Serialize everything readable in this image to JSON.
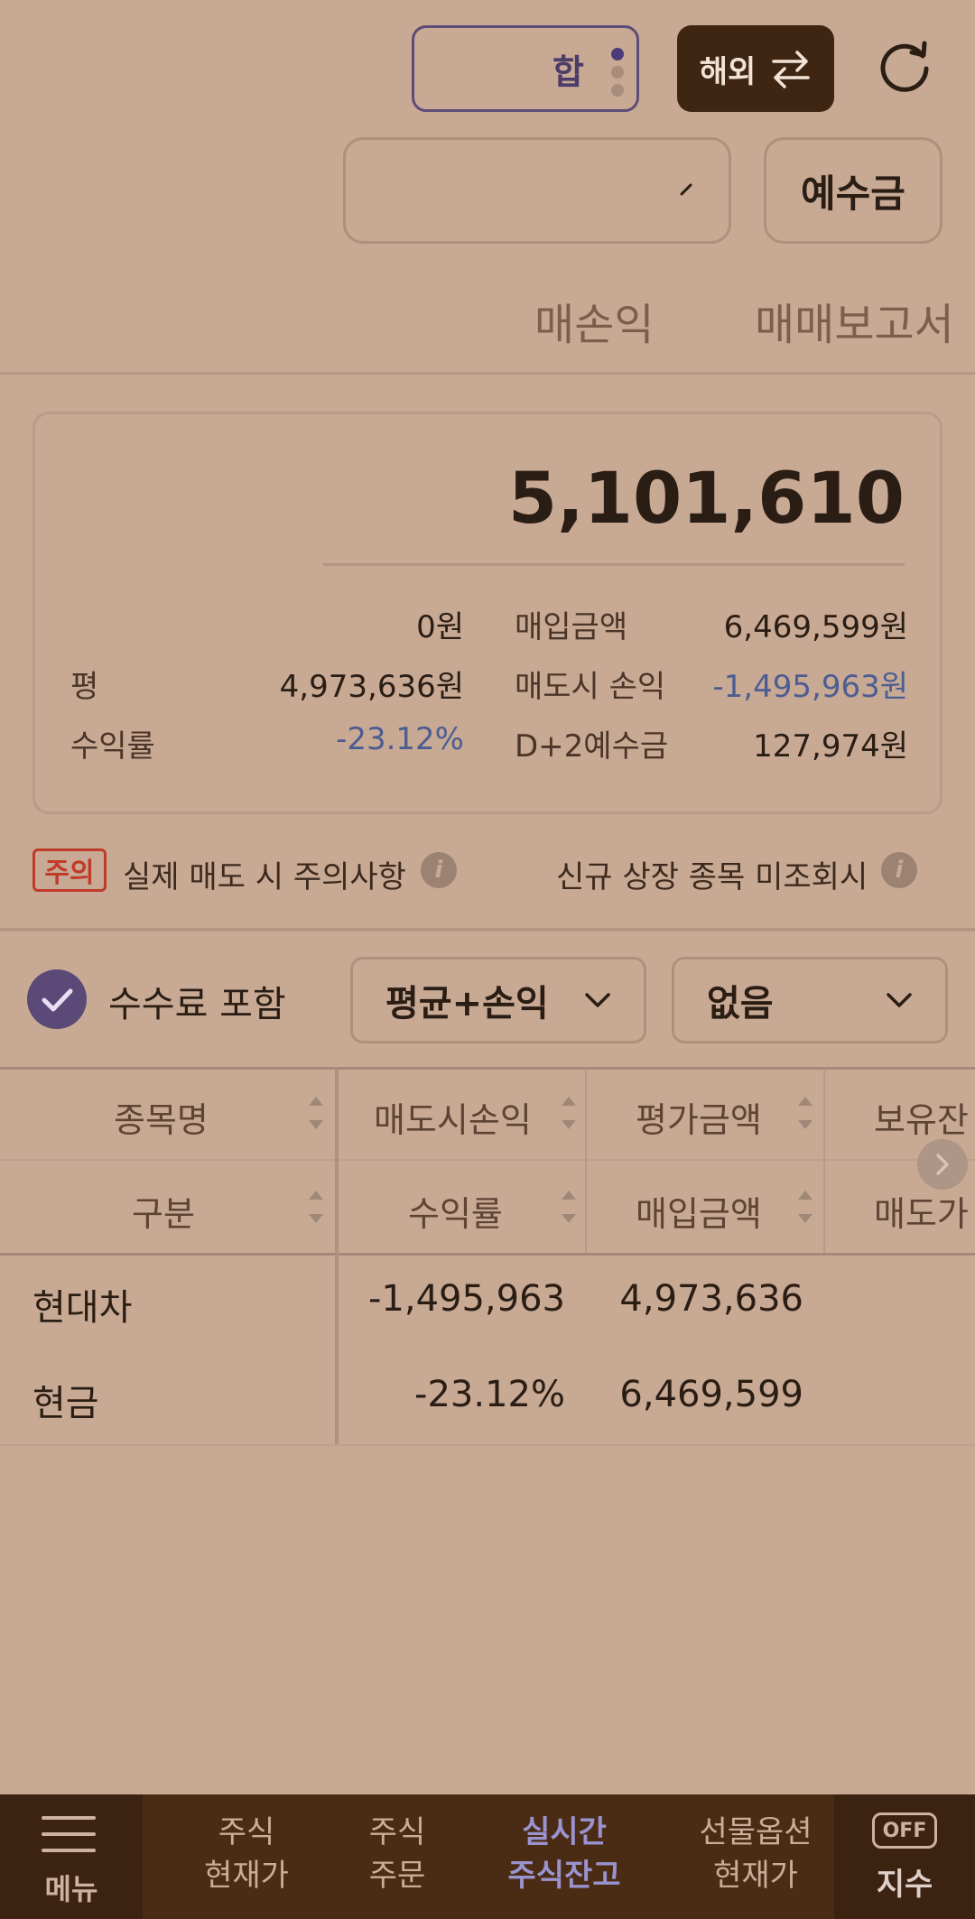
{
  "top": {
    "account_mode_label": "합",
    "overseas_label": "해외",
    "deposit_label": "예수금"
  },
  "tabs": [
    {
      "label": "매손익"
    },
    {
      "label": "매매보고서"
    }
  ],
  "summary": {
    "total_value": "5,101,610",
    "left_rows": [
      {
        "label": "",
        "value": "0원"
      },
      {
        "label": "평",
        "value": "4,973,636원"
      },
      {
        "label": "수익률",
        "value": "-23.12%"
      }
    ],
    "right_rows": [
      {
        "label": "매입금액",
        "value": "6,469,599원"
      },
      {
        "label": "매도시 손익",
        "value": "-1,495,963원"
      },
      {
        "label": "D+2예수금",
        "value": "127,974원"
      }
    ]
  },
  "notice": {
    "badge": "주의",
    "caution_text": "실제 매도 시 주의사항",
    "new_listing_text": "신규 상장 종목 미조회시"
  },
  "filters": {
    "fee_label": "수수료 포함",
    "calc_mode": "평균+손익",
    "option": "없음"
  },
  "table": {
    "header_row1": [
      "종목명",
      "매도시손익",
      "평가금액",
      "보유잔"
    ],
    "header_row2": [
      "구분",
      "수익률",
      "매입금액",
      "매도가"
    ],
    "rows": [
      {
        "name": "현대차",
        "pnl": "-1,495,963",
        "value": "4,973,636"
      },
      {
        "name": "현금",
        "pnl": "-23.12%",
        "value": "6,469,599"
      }
    ]
  },
  "nav": {
    "menu_label": "메뉴",
    "items": [
      {
        "line1": "주식",
        "line2": "현재가"
      },
      {
        "line1": "주식",
        "line2": "주문"
      },
      {
        "line1": "실시간",
        "line2": "주식잔고"
      },
      {
        "line1": "선물옵션",
        "line2": "현재가"
      }
    ],
    "off_badge": "OFF",
    "index_label": "지수"
  },
  "colors": {
    "background": "#c8a994",
    "negative": "#4c5d92",
    "accent": "#5b4a78",
    "nav_background": "#4a2c15",
    "caution": "#c13a2a"
  }
}
